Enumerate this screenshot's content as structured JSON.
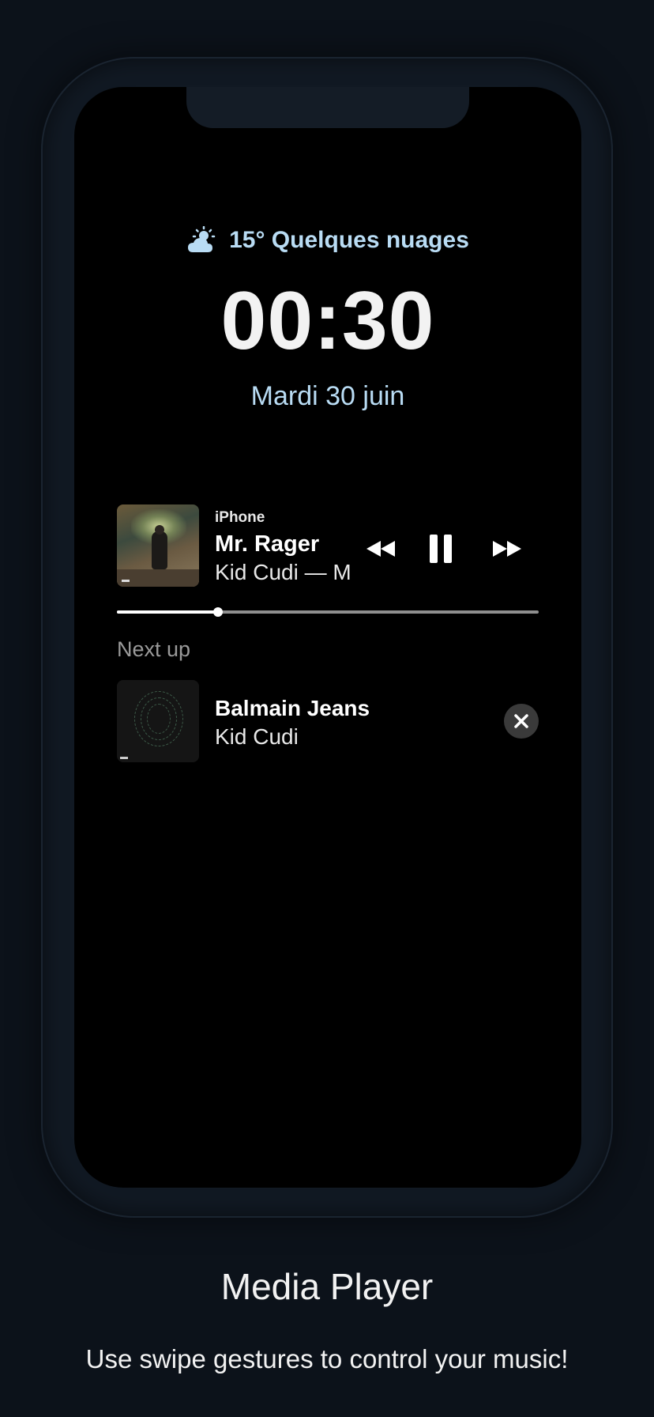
{
  "lock_screen": {
    "weather": {
      "icon": "partly-cloudy-icon",
      "text": "15° Quelques nuages",
      "color": "#b9dcf4"
    },
    "time": "00:30",
    "date": "Mardi 30 juin"
  },
  "now_playing": {
    "source": "iPhone",
    "title": "Mr. Rager",
    "artist_album": "Kid Cudi — M",
    "progress": 0.24,
    "controls": {
      "previous": "rewind-icon",
      "pause": "pause-icon",
      "next": "fast-forward-icon"
    }
  },
  "queue": {
    "label": "Next up",
    "items": [
      {
        "title": "Balmain Jeans",
        "artist": "Kid Cudi",
        "remove_icon": "close-icon"
      }
    ]
  },
  "promo": {
    "title": "Media Player",
    "description": "Use swipe gestures to control your music!"
  }
}
